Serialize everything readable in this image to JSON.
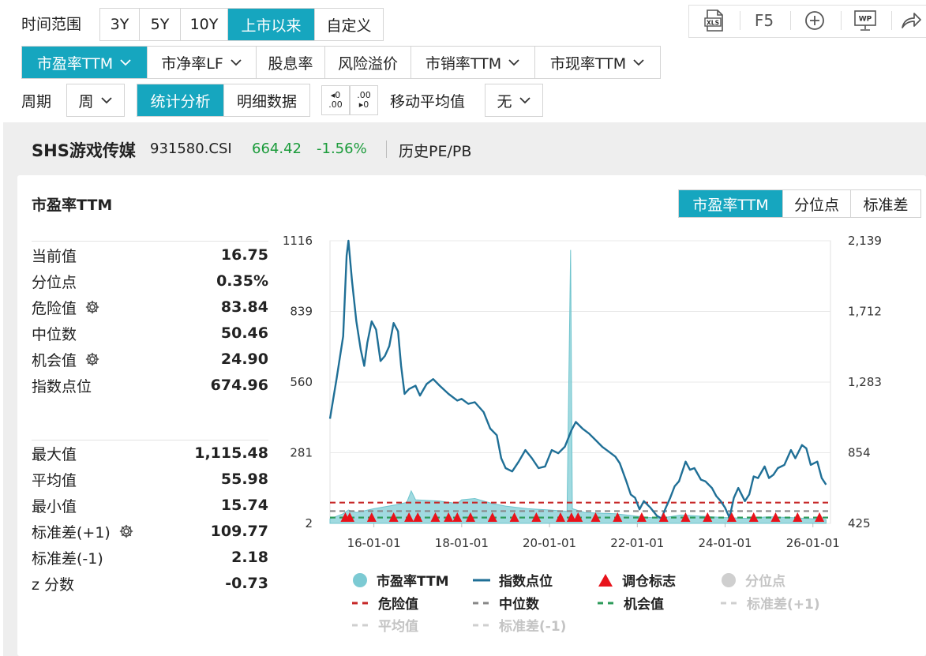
{
  "toolbar": {
    "time_range_label": "时间范围",
    "time_ranges": [
      "3Y",
      "5Y",
      "10Y",
      "上市以来",
      "自定义"
    ],
    "active_time_range": 3,
    "metrics": [
      "市盈率TTM",
      "市净率LF",
      "股息率",
      "风险溢价",
      "市销率TTM",
      "市现率TTM"
    ],
    "active_metric": 0,
    "period_label": "周期",
    "period_value": "周",
    "analysis_tabs": [
      "统计分析",
      "明细数据"
    ],
    "active_analysis": 0,
    "moving_avg_label": "移动平均值",
    "moving_avg_value": "无",
    "decimal_increase": ".00",
    "decimal_decrease": ".00",
    "right_buttons": {
      "xls": "XLS",
      "f5": "F5",
      "plus": "+",
      "wp": "WP"
    }
  },
  "header": {
    "name": "SHS游戏传媒",
    "code": "931580.CSI",
    "price": "664.42",
    "change": "-1.56%",
    "history_link": "历史PE/PB"
  },
  "card": {
    "title": "市盈率TTM",
    "view_tabs": [
      "市盈率TTM",
      "分位点",
      "标准差"
    ],
    "active_view": 0
  },
  "stats_top": [
    {
      "label": "当前值",
      "value": "16.75",
      "gear": false
    },
    {
      "label": "分位点",
      "value": "0.35%",
      "gear": false
    },
    {
      "label": "危险值",
      "value": "83.84",
      "gear": true
    },
    {
      "label": "中位数",
      "value": "50.46",
      "gear": false
    },
    {
      "label": "机会值",
      "value": "24.90",
      "gear": true
    },
    {
      "label": "指数点位",
      "value": "674.96",
      "gear": false
    }
  ],
  "stats_bottom": [
    {
      "label": "最大值",
      "value": "1,115.48",
      "gear": false
    },
    {
      "label": "平均值",
      "value": "55.98",
      "gear": false
    },
    {
      "label": "最小值",
      "value": "15.74",
      "gear": false
    },
    {
      "label": "标准差(+1)",
      "value": "109.77",
      "gear": true
    },
    {
      "label": "标准差(-1)",
      "value": "2.18",
      "gear": false
    },
    {
      "label": "z 分数",
      "value": "-0.73",
      "gear": false
    }
  ],
  "chart_data": {
    "type": "line",
    "left_axis": {
      "ticks": [
        "1116",
        "839",
        "560",
        "281",
        "2"
      ],
      "min": 2,
      "max": 1116
    },
    "right_axis": {
      "ticks": [
        "2,139",
        "1,712",
        "1,283",
        "854",
        "425"
      ],
      "min": 425,
      "max": 2139
    },
    "x_ticks": [
      "16-01-01",
      "18-01-01",
      "20-01-01",
      "22-01-01",
      "24-01-01",
      "26-01-01"
    ],
    "x_range": [
      2015.0,
      2026.4
    ],
    "series": [
      {
        "name": "指数点位",
        "axis": "right",
        "color": "#1f6f96",
        "points": [
          [
            2015.0,
            1060
          ],
          [
            2015.15,
            1300
          ],
          [
            2015.3,
            1560
          ],
          [
            2015.38,
            2050
          ],
          [
            2015.42,
            2139
          ],
          [
            2015.5,
            1900
          ],
          [
            2015.6,
            1650
          ],
          [
            2015.7,
            1480
          ],
          [
            2015.78,
            1380
          ],
          [
            2015.85,
            1520
          ],
          [
            2015.95,
            1650
          ],
          [
            2016.05,
            1600
          ],
          [
            2016.15,
            1410
          ],
          [
            2016.25,
            1440
          ],
          [
            2016.35,
            1500
          ],
          [
            2016.45,
            1640
          ],
          [
            2016.55,
            1590
          ],
          [
            2016.62,
            1380
          ],
          [
            2016.7,
            1210
          ],
          [
            2016.8,
            1240
          ],
          [
            2016.95,
            1260
          ],
          [
            2017.05,
            1200
          ],
          [
            2017.2,
            1270
          ],
          [
            2017.35,
            1300
          ],
          [
            2017.5,
            1260
          ],
          [
            2017.7,
            1210
          ],
          [
            2017.9,
            1170
          ],
          [
            2018.0,
            1180
          ],
          [
            2018.15,
            1150
          ],
          [
            2018.3,
            1160
          ],
          [
            2018.5,
            1100
          ],
          [
            2018.65,
            1000
          ],
          [
            2018.8,
            960
          ],
          [
            2018.9,
            820
          ],
          [
            2019.0,
            760
          ],
          [
            2019.15,
            740
          ],
          [
            2019.3,
            800
          ],
          [
            2019.45,
            870
          ],
          [
            2019.6,
            820
          ],
          [
            2019.75,
            760
          ],
          [
            2019.9,
            770
          ],
          [
            2020.05,
            870
          ],
          [
            2020.2,
            850
          ],
          [
            2020.35,
            890
          ],
          [
            2020.5,
            990
          ],
          [
            2020.6,
            1040
          ],
          [
            2020.75,
            1000
          ],
          [
            2020.9,
            970
          ],
          [
            2021.05,
            930
          ],
          [
            2021.2,
            890
          ],
          [
            2021.35,
            860
          ],
          [
            2021.5,
            830
          ],
          [
            2021.6,
            790
          ],
          [
            2021.75,
            680
          ],
          [
            2021.85,
            600
          ],
          [
            2021.95,
            580
          ],
          [
            2022.05,
            510
          ],
          [
            2022.15,
            560
          ],
          [
            2022.3,
            520
          ],
          [
            2022.45,
            470
          ],
          [
            2022.55,
            455
          ],
          [
            2022.65,
            520
          ],
          [
            2022.75,
            580
          ],
          [
            2022.85,
            650
          ],
          [
            2022.95,
            680
          ],
          [
            2023.1,
            800
          ],
          [
            2023.2,
            750
          ],
          [
            2023.3,
            760
          ],
          [
            2023.45,
            690
          ],
          [
            2023.55,
            680
          ],
          [
            2023.7,
            640
          ],
          [
            2023.8,
            590
          ],
          [
            2023.9,
            560
          ],
          [
            2024.0,
            520
          ],
          [
            2024.1,
            460
          ],
          [
            2024.2,
            580
          ],
          [
            2024.3,
            640
          ],
          [
            2024.45,
            560
          ],
          [
            2024.55,
            600
          ],
          [
            2024.65,
            710
          ],
          [
            2024.75,
            700
          ],
          [
            2024.9,
            770
          ],
          [
            2025.0,
            700
          ],
          [
            2025.1,
            720
          ],
          [
            2025.2,
            760
          ],
          [
            2025.35,
            780
          ],
          [
            2025.5,
            870
          ],
          [
            2025.6,
            820
          ],
          [
            2025.75,
            900
          ],
          [
            2025.85,
            880
          ],
          [
            2025.95,
            780
          ],
          [
            2026.1,
            800
          ],
          [
            2026.2,
            700
          ],
          [
            2026.3,
            660
          ]
        ]
      },
      {
        "name": "市盈率TTM",
        "axis": "left",
        "color": "#8fd3da",
        "points": [
          [
            2015.0,
            20
          ],
          [
            2015.3,
            40
          ],
          [
            2015.42,
            55
          ],
          [
            2015.6,
            45
          ],
          [
            2016.0,
            60
          ],
          [
            2016.5,
            75
          ],
          [
            2016.75,
            85
          ],
          [
            2016.85,
            130
          ],
          [
            2016.95,
            95
          ],
          [
            2017.5,
            90
          ],
          [
            2017.9,
            80
          ],
          [
            2018.0,
            95
          ],
          [
            2018.3,
            100
          ],
          [
            2018.7,
            80
          ],
          [
            2019.0,
            70
          ],
          [
            2019.5,
            60
          ],
          [
            2020.0,
            55
          ],
          [
            2020.4,
            50
          ],
          [
            2020.48,
            1080
          ],
          [
            2020.52,
            60
          ],
          [
            2020.8,
            45
          ],
          [
            2021.5,
            40
          ],
          [
            2022.0,
            30
          ],
          [
            2022.5,
            22
          ],
          [
            2023.0,
            35
          ],
          [
            2023.5,
            30
          ],
          [
            2024.0,
            25
          ],
          [
            2024.5,
            22
          ],
          [
            2025.0,
            28
          ],
          [
            2025.5,
            25
          ],
          [
            2026.0,
            20
          ],
          [
            2026.3,
            17
          ]
        ]
      }
    ],
    "reference_lines": [
      {
        "name": "危险值",
        "value": 83.84,
        "color": "#c62828"
      },
      {
        "name": "中位数",
        "value": 50.46,
        "color": "#888888"
      },
      {
        "name": "机会值",
        "value": 24.9,
        "color": "#2e9b5b"
      }
    ],
    "rebalance_markers": [
      2015.35,
      2015.45,
      2015.95,
      2016.45,
      2016.8,
      2017.0,
      2017.4,
      2017.7,
      2017.9,
      2018.2,
      2018.7,
      2019.2,
      2019.7,
      2020.25,
      2020.5,
      2020.65,
      2021.05,
      2021.55,
      2022.1,
      2022.6,
      2023.1,
      2023.6,
      2024.15,
      2024.65,
      2025.15,
      2025.65,
      2026.15
    ],
    "legend": [
      {
        "label": "市盈率TTM",
        "kind": "circle",
        "color": "#7ccad3",
        "dim": false
      },
      {
        "label": "指数点位",
        "kind": "line",
        "color": "#1f6f96",
        "dim": false
      },
      {
        "label": "调仓标志",
        "kind": "triangle",
        "color": "#e8131b",
        "dim": false
      },
      {
        "label": "分位点",
        "kind": "circle",
        "color": "#cfcfcf",
        "dim": true
      },
      {
        "label": "危险值",
        "kind": "dash",
        "color": "#c62828",
        "dim": false
      },
      {
        "label": "中位数",
        "kind": "dash",
        "color": "#888888",
        "dim": false
      },
      {
        "label": "机会值",
        "kind": "dash",
        "color": "#2e9b5b",
        "dim": false
      },
      {
        "label": "标准差(+1)",
        "kind": "dash",
        "color": "#cfcfcf",
        "dim": true
      },
      {
        "label": "平均值",
        "kind": "dash",
        "color": "#cfcfcf",
        "dim": true
      },
      {
        "label": "标准差(-1)",
        "kind": "dash",
        "color": "#cfcfcf",
        "dim": true
      }
    ]
  }
}
